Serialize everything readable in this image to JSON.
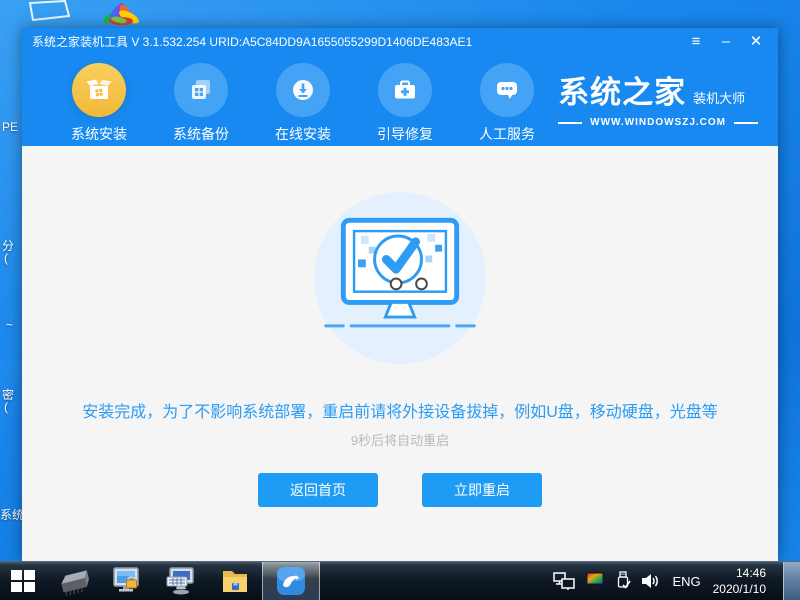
{
  "window": {
    "title": "系统之家装机工具 V 3.1.532.254 URID:A5C84DD9A1655055299D1406DE483AE1",
    "controls": {
      "menu": "≡",
      "minimize": "–",
      "close": "✕"
    }
  },
  "nav": {
    "items": [
      {
        "label": "系统安装",
        "active": true
      },
      {
        "label": "系统备份",
        "active": false
      },
      {
        "label": "在线安装",
        "active": false
      },
      {
        "label": "引导修复",
        "active": false
      },
      {
        "label": "人工服务",
        "active": false
      }
    ],
    "logo": {
      "brand": "系统之家",
      "tagline": "装机大师",
      "website": "WWW.WINDOWSZJ.COM"
    }
  },
  "content": {
    "message": "安装完成，为了不影响系统部署，重启前请将外接设备拔掉，例如U盘，移动硬盘，光盘等",
    "countdown": "9秒后将自动重启",
    "home_button": "返回首页",
    "restart_button": "立即重启"
  },
  "desktop": {
    "label_fragments": [
      "PE",
      "分",
      "(",
      "~",
      "密",
      "(",
      "系统"
    ]
  },
  "taskbar": {
    "language": "ENG",
    "time": "14:46",
    "date": "2020/1/10"
  },
  "colors": {
    "titlebar_blue": "#1789f0",
    "nav_circle_blue": "#44a3f4",
    "active_gold": "#f2bb3f",
    "content_bg": "#f5f5f6",
    "message_blue": "#2b9cf4",
    "button_blue": "#1e9cf5",
    "illustration_bg": "#e4f0fd"
  }
}
